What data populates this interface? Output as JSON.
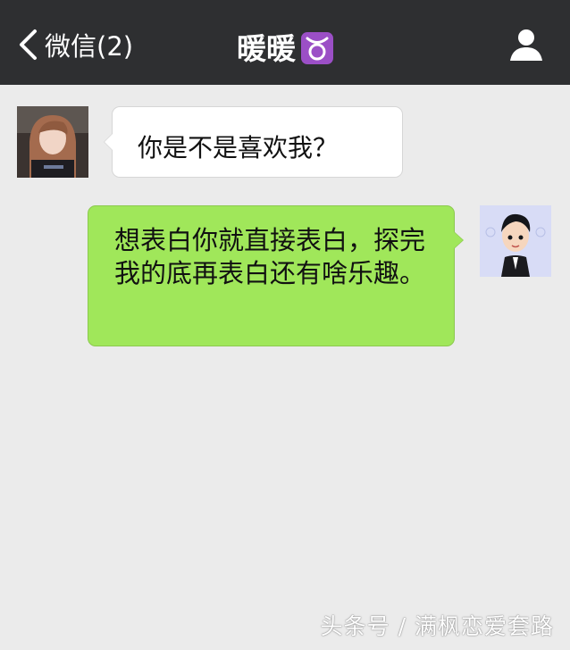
{
  "header": {
    "back_label": "微信(2)",
    "title": "暖暖",
    "title_emoji": "taurus-icon",
    "profile_icon": "person-icon",
    "background": "#2e2f31"
  },
  "messages": [
    {
      "side": "received",
      "text": "你是不是喜欢我？",
      "bubble_color": "#ffffff"
    },
    {
      "side": "sent",
      "text": "想表白你就直接表白，探完我的底再表白还有啥乐趣。",
      "bubble_color": "#a0e75a"
    }
  ],
  "watermark": "头条号 / 满枫恋爱套路",
  "colors": {
    "chat_background": "#ebebeb"
  }
}
